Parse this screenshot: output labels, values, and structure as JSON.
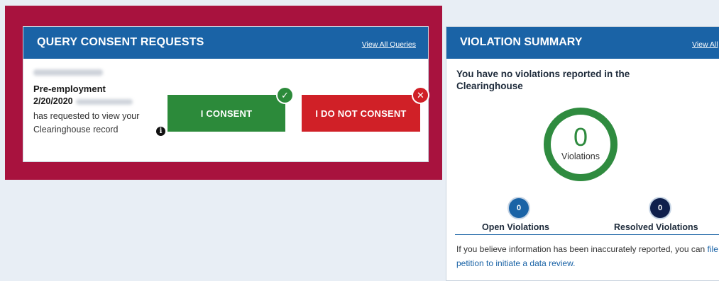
{
  "query_panel": {
    "title": "QUERY CONSENT REQUESTS",
    "view_all": "View All Queries",
    "request_type": "Pre-employment",
    "request_date": "2/20/2020",
    "request_text": "has requested to view your Clearinghouse record",
    "consent_label": "I CONSENT",
    "no_consent_label": "I DO NOT CONSENT",
    "frame_color": "#a8123e",
    "consent_color": "#2c8a3a",
    "no_consent_color": "#d02027"
  },
  "violation_panel": {
    "title": "VIOLATION SUMMARY",
    "view_all": "View All",
    "message": "You have no violations reported in the Clearinghouse",
    "total_count": "0",
    "total_label": "Violations",
    "open_count": "0",
    "open_label": "Open Violations",
    "resolved_count": "0",
    "resolved_label": "Resolved Violations",
    "footer_prefix": "If you believe information has been inaccurately reported, you can ",
    "footer_link": "file a petition to initiate a data review.",
    "header_color": "#1a63a6"
  }
}
